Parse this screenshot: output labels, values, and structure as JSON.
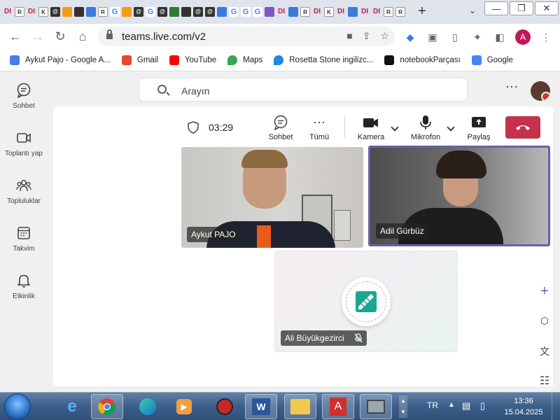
{
  "browser": {
    "new_tab_label": "+",
    "url": "teams.live.com/v2",
    "profile_initial": "A",
    "tab_favicons": [
      {
        "icon": "di-icon",
        "text": "DI",
        "style": "di"
      },
      {
        "icon": "rosetta-re-icon",
        "text": "R",
        "style": "re"
      },
      {
        "icon": "di-icon",
        "text": "DI",
        "style": "di"
      },
      {
        "icon": "ki-icon",
        "text": "K",
        "style": "re"
      },
      {
        "icon": "spiral-icon",
        "text": "@",
        "style": "dk"
      },
      {
        "icon": "gear-icon",
        "text": "",
        "style": "or"
      },
      {
        "icon": "ext-icon",
        "text": "",
        "style": "dk"
      },
      {
        "icon": "shield-icon",
        "text": "",
        "style": "bl"
      },
      {
        "icon": "rosetta-re-icon",
        "text": "R",
        "style": "re"
      },
      {
        "icon": "google-g-icon",
        "text": "G",
        "style": "g"
      },
      {
        "icon": "ext-icon",
        "text": "",
        "style": "or"
      },
      {
        "icon": "spiral-icon",
        "text": "@",
        "style": "dk"
      },
      {
        "icon": "google-g-icon",
        "text": "G",
        "style": "g"
      },
      {
        "icon": "spiral-icon",
        "text": "@",
        "style": "dk"
      },
      {
        "icon": "ext-icon",
        "text": "",
        "style": "gr"
      },
      {
        "icon": "ext-icon",
        "text": "",
        "style": "dk"
      },
      {
        "icon": "spiral-icon",
        "text": "@",
        "style": "dk"
      },
      {
        "icon": "spiral-icon",
        "text": "@",
        "style": "dk"
      },
      {
        "icon": "diamond-icon",
        "text": "",
        "style": "bl"
      },
      {
        "icon": "google-g-icon",
        "text": "G",
        "style": "g"
      },
      {
        "icon": "google-g-icon",
        "text": "G",
        "style": "g"
      },
      {
        "icon": "google-g-icon",
        "text": "G",
        "style": "g"
      },
      {
        "icon": "wave-icon",
        "text": "",
        "style": "pu"
      },
      {
        "icon": "di-icon",
        "text": "DI",
        "style": "di"
      },
      {
        "icon": "ext-icon",
        "text": "",
        "style": "bl"
      },
      {
        "icon": "rosetta-re-icon",
        "text": "R",
        "style": "re"
      },
      {
        "icon": "di-icon",
        "text": "DI",
        "style": "di"
      },
      {
        "icon": "ki-icon",
        "text": "K",
        "style": "re"
      },
      {
        "icon": "di-icon",
        "text": "DI",
        "style": "di"
      },
      {
        "icon": "diamond-icon",
        "text": "",
        "style": "bl"
      },
      {
        "icon": "di-icon",
        "text": "DI",
        "style": "di"
      },
      {
        "icon": "di-icon",
        "text": "DI",
        "style": "di"
      },
      {
        "icon": "rosetta-re-icon",
        "text": "R",
        "style": "re"
      },
      {
        "icon": "rosetta-re-icon",
        "text": "R",
        "style": "re"
      }
    ],
    "bookmarks": [
      {
        "label": "Aykut Pajo - Google A...",
        "icon": "google-ads-icon",
        "color": "#4b7bec"
      },
      {
        "label": "Gmail",
        "icon": "gmail-icon",
        "color": "#ea4335"
      },
      {
        "label": "YouTube",
        "icon": "youtube-icon",
        "color": "#ff0000"
      },
      {
        "label": "Maps",
        "icon": "maps-pin-icon",
        "color": "#34a853"
      },
      {
        "label": "Rosetta Stone ingilizc...",
        "icon": "rosetta-drop-icon",
        "color": "#1e88e5"
      },
      {
        "label": "notebookParçası",
        "icon": "notebook-icon",
        "color": "#111111"
      },
      {
        "label": "Google",
        "icon": "google-g-icon",
        "color": "#4285f4"
      }
    ]
  },
  "teams": {
    "search_placeholder": "Arayın",
    "rail": [
      {
        "label": "Sohbet",
        "icon": "chat-icon"
      },
      {
        "label": "Toplantı yap",
        "icon": "video-camera-icon"
      },
      {
        "label": "Topluluklar",
        "icon": "communities-icon"
      },
      {
        "label": "Takvim",
        "icon": "calendar-icon"
      },
      {
        "label": "Etkinlik",
        "icon": "bell-icon"
      }
    ],
    "call": {
      "timer": "03:29",
      "chat_label": "Sohbet",
      "more_label": "Tümü",
      "camera_label": "Kamera",
      "mic_label": "Mikrofon",
      "share_label": "Paylaş"
    },
    "participants": [
      {
        "name": "Aykut PAJO"
      },
      {
        "name": "Adil Gürbüz"
      },
      {
        "name": "Ali Büyükgezirci"
      }
    ],
    "colors": {
      "accent": "#6264a7",
      "leave": "#c4314b"
    }
  },
  "taskbar": {
    "language": "TR",
    "time": "13:36",
    "date": "15.04.2025",
    "apps": [
      "internet-explorer-icon",
      "chrome-icon",
      "edge-icon",
      "media-player-icon",
      "antivirus-icon",
      "word-icon",
      "file-explorer-icon",
      "acrobat-icon",
      "computer-icon"
    ]
  }
}
